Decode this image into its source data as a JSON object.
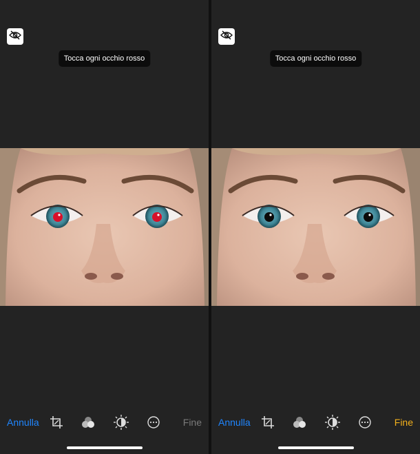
{
  "panels": [
    {
      "id": "before",
      "hint": "Tocca ogni occhio rosso",
      "toolbar": {
        "cancel_label": "Annulla",
        "done_label": "Fine",
        "done_enabled": false,
        "icons": [
          "crop-icon",
          "filters-icon",
          "adjust-icon",
          "more-icon"
        ]
      },
      "pupil_color": "#d8102a"
    },
    {
      "id": "after",
      "hint": "Tocca ogni occhio rosso",
      "toolbar": {
        "cancel_label": "Annulla",
        "done_label": "Fine",
        "done_enabled": true,
        "icons": [
          "crop-icon",
          "filters-icon",
          "adjust-icon",
          "more-icon"
        ]
      },
      "pupil_color": "#0a0a0a"
    }
  ],
  "colors": {
    "cancel": "#1f86ff",
    "done_active": "#f3b11c",
    "done_inactive": "#7a7a7a",
    "background": "#232323"
  }
}
